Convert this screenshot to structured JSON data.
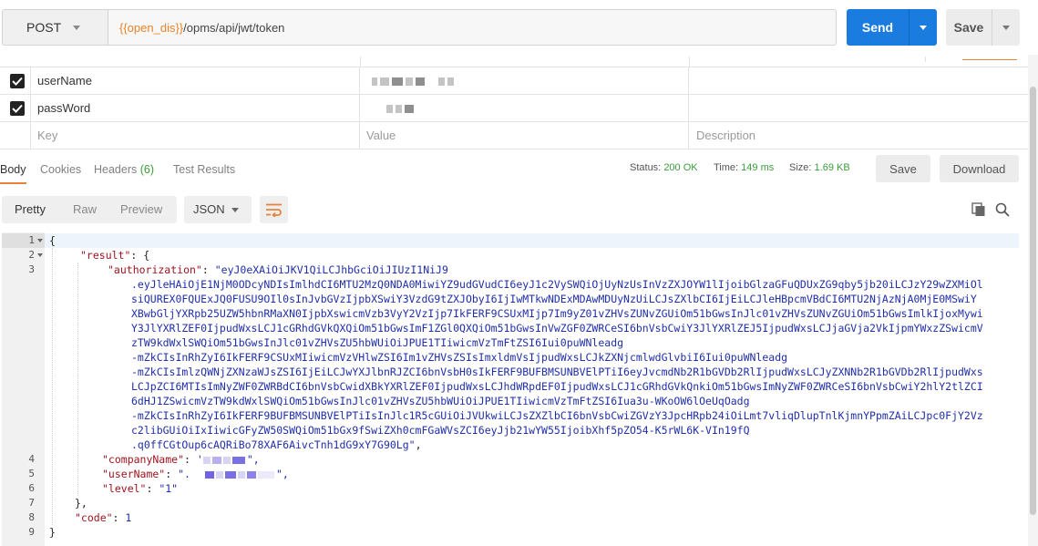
{
  "request": {
    "method": "POST",
    "url_variable": "{{open_dis}}",
    "url_path": "/opms/api/jwt/token",
    "send_label": "Send",
    "save_label": "Save"
  },
  "params": {
    "rows": [
      {
        "key": "userName",
        "enabled": true
      },
      {
        "key": "passWord",
        "enabled": true
      }
    ],
    "placeholder": {
      "key": "Key",
      "value": "Value",
      "description": "Description"
    }
  },
  "response_tabs": {
    "body": "Body",
    "cookies": "Cookies",
    "headers": "Headers",
    "headers_count": "(6)",
    "test_results": "Test Results"
  },
  "status": {
    "status_label": "Status:",
    "status_value": "200 OK",
    "time_label": "Time:",
    "time_value": "149 ms",
    "size_label": "Size:",
    "size_value": "1.69 KB",
    "save_response_label": "Save",
    "download_label": "Download"
  },
  "view_modes": {
    "pretty": "Pretty",
    "raw": "Raw",
    "preview": "Preview",
    "format": "JSON"
  },
  "code": {
    "line_numbers": [
      "1",
      "2",
      "3",
      "4",
      "5",
      "6",
      "7",
      "8",
      "9"
    ],
    "l1": "{",
    "l2_key": "\"result\"",
    "l2_rest": ": {",
    "l3_key": "\"authorization\"",
    "l3_colon": ": ",
    "token_lines": [
      "\"eyJ0eXAiOiJKV1QiLCJhbGciOiJIUzI1NiJ9",
      ".eyJleHAiOjE1NjM0ODcyNDIsImlhdCI6MTU2MzQ0NDA0MiwiYZ9udGVudCI6eyJ1c2VySWQiOjUyNzUsInVzZXJOYW1lIjoibGlzaGFuQDUxZG9qby5jb20iLCJzY29wZXMiOl",
      "siQUREX0FQUExJQ0FUSU9OIl0sInJvbGVzIjpbXSwiY3VzdG9tZXJObyI6IjIwMTkwNDExMDAwMDUyNzUiLCJsZXlbCI6IjEiLCJleHBpcmVBdCI6MTU2NjAzNjA0MjE0MSwiY",
      "XBwbGljYXRpb25UZW5hbnRMaXN0IjpbXswicmVzb3VyY2VzIjp7IkFERF9CSUxMIjp7Im9yZ01vZHVsZUNvZGUiOm51bGwsInJlc01vZHVsZUNvZGUiOm51bGwsImlkIjoxMywi",
      "Y3JlYXRlZEF0IjpudWxsLCJ1cGRhdGVkQXQiOm51bGwsImF1ZGl0QXQiOm51bGwsInVwZGF0ZWRCeSI6bnVsbCwiY3JlYXRlZEJ5IjpudWxsLCJjaGVja2VkIjpmYWxzZSwicmV",
      "zTW9kdWxlSWQiOm51bGwsInJlc01vZHVsZU5hbWUiOiJPUE1TIiwicmVzTmFtZSI6Iui0puWNleadg",
      "-mZkCIsInRhZyI6IkFERF9CSUxMIiwicmVzVHlwZSI6Im1vZHVsZSIsImxldmVsIjpudWxsLCJkZXNjcmlwdGlvbiI6Iui0puWNleadg",
      "-mZkCIsImlzQWNjZXNzaWJsZSI6IjEiLCJwYXJlbnRJZCI6bnVsbH0sIkFERF9BUFBMSUNBVElPTiI6eyJvcmdNb2R1bGVDb2RlIjpudWxsLCJyZXNNb2R1bGVDb2RlIjpudWxs",
      "LCJpZCI6MTIsImNyZWF0ZWRBdCI6bnVsbCwidXBkYXRlZEF0IjpudWxsLCJhdWRpdEF0IjpudWxsLCJ1cGRhdGVkQnkiOm51bGwsImNyZWF0ZWRCeSI6bnVsbCwiY2hlY2tlZCI",
      "6dHJ1ZSwicmVzTW9kdWxlSWQiOm51bGwsInJlc01vZHVsZU5hbWUiOiJPUE1TIiwicmVzTmFtZSI6Iua3u-WKoOW6lOeUqOadg",
      "-mZkCIsInRhZyI6IkFERF9BUFBMSUNBVElPTiIsInJlc1R5cGUiOiJVUkwiLCJsZXZlbCI6bnVsbCwiZGVzY3JpcHRpb24iOiLmt7vliqDlupTnlKjmnYPpmZAiLCJpc0FjY2Vz",
      "c2libGUiOiIxIiwicGFyZW50SWQiOm51bGx9fSwiZXh0cmFGaWVsZCI6eyJjb21wYW55IjoibXhf5pZO54-K5rWL6K-VIn19fQ",
      ".q0ffCGtOup6cAQRiBo78XAF6AivcTnh1dG9xY7G90Lg\""
    ],
    "token_end": ",",
    "l4_key": "\"companyName\"",
    "l4_colon": ": ",
    "l4_value_open": "'",
    "l4_tail": "\",",
    "l5_key": "\"userName\"",
    "l5_colon": ": ",
    "l5_value_open": "\".",
    "l5_tail": "\",",
    "l6_key": "\"level\"",
    "l6_rest": ": ",
    "l6_value": "\"1\"",
    "l7": "},",
    "l8_key": "\"code\"",
    "l8_rest": ": ",
    "l8_value": "1",
    "l9": "}"
  },
  "colors": {
    "send_blue": "#1b7cdf",
    "accent_orange": "#e8823a",
    "status_green": "#3a9d3a",
    "json_key": "#a1141e",
    "json_string": "#1f2fa8",
    "url_variable": "#e8832a"
  },
  "icons": {
    "wrap": "wrap-lines-icon",
    "copy": "copy-icon",
    "search": "search-icon",
    "checkbox": "checkbox-checked-icon"
  }
}
